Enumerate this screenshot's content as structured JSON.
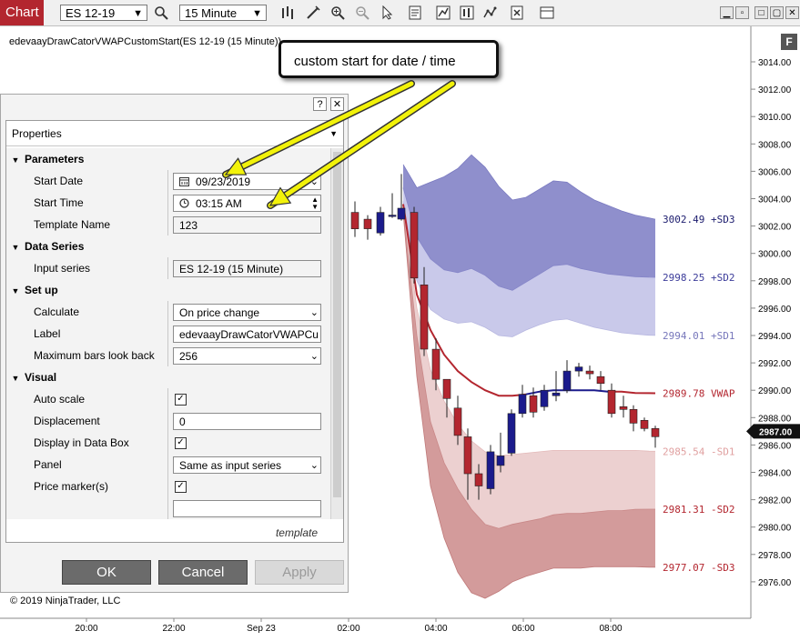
{
  "toolbar": {
    "chart_tab": "Chart",
    "instrument": "ES 12-19",
    "interval": "15 Minute",
    "icons": [
      "search-icon",
      "bar-style-icon",
      "draw-tool-icon",
      "zoom-in-icon",
      "zoom-out-icon",
      "cursor-icon",
      "properties-icon",
      "indicators-icon",
      "strategies-icon",
      "snapshot-icon",
      "template-icon"
    ],
    "window_buttons": [
      "minimize-icon",
      "maximize-icon",
      "close-icon"
    ]
  },
  "chart": {
    "title": "edevaayDrawCatorVWAPCustomStart(ES 12-19 (15 Minute))",
    "f_button": "F",
    "copyright": "© 2019 NinjaTrader, LLC",
    "price_axis": [
      "3014.00",
      "3012.00",
      "3010.00",
      "3008.00",
      "3006.00",
      "3004.00",
      "3002.00",
      "3000.00",
      "2998.00",
      "2996.00",
      "2994.00",
      "2992.00",
      "2990.00",
      "2988.00",
      "2986.00",
      "2984.00",
      "2982.00",
      "2980.00",
      "2978.00",
      "2976.00"
    ],
    "time_axis": [
      "20:00",
      "22:00",
      "Sep 23",
      "02:00",
      "04:00",
      "06:00",
      "08:00"
    ],
    "last_price": "2987.00",
    "band_labels": {
      "sd3_up": "3002.49 +SD3",
      "sd2_up": "2998.25 +SD2",
      "sd1_up": "2994.01 +SD1",
      "vwap": "2989.78 VWAP",
      "sd1_dn": "2985.54 -SD1",
      "sd2_dn": "2981.31 -SD2",
      "sd3_dn": "2977.07 -SD3"
    },
    "colors": {
      "upper_band_dark": "#8f8fcc",
      "upper_band_light": "#c9c9ea",
      "lower_band_light": "#ecd0d0",
      "lower_band_dark": "#d39b9b",
      "vwap": "#b3262f",
      "up_candle": "#1b1b8c",
      "down_candle": "#b3262f",
      "callout_arrow": "#f2f20a"
    }
  },
  "callout": {
    "text": "custom start for date / time"
  },
  "dialog": {
    "help": "?",
    "close": "✕",
    "header": "Properties",
    "categories": {
      "parameters": "Parameters",
      "data_series": "Data Series",
      "setup": "Set up",
      "visual": "Visual"
    },
    "fields": {
      "start_date_label": "Start Date",
      "start_date_value": "09/23/2019",
      "start_time_label": "Start Time",
      "start_time_value": "03:15 AM",
      "template_name_label": "Template Name",
      "template_name_value": "123",
      "input_series_label": "Input series",
      "input_series_value": "ES 12-19 (15 Minute)",
      "calculate_label": "Calculate",
      "calculate_value": "On price change",
      "label_label": "Label",
      "label_value": "edevaayDrawCatorVWAPCu",
      "max_bars_label": "Maximum bars look back",
      "max_bars_value": "256",
      "auto_scale_label": "Auto scale",
      "displacement_label": "Displacement",
      "displacement_value": "0",
      "display_data_box_label": "Display in Data Box",
      "panel_label": "Panel",
      "panel_value": "Same as input series",
      "price_markers_label": "Price marker(s)"
    },
    "template_link": "template",
    "ok": "OK",
    "cancel": "Cancel",
    "apply": "Apply"
  }
}
